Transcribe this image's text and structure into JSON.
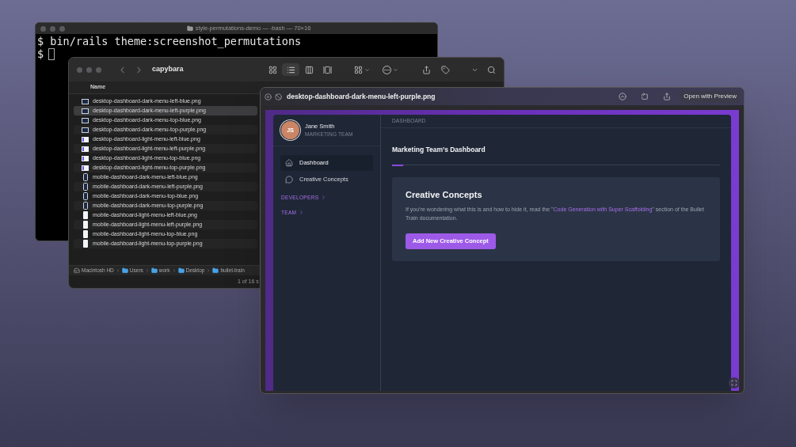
{
  "terminal": {
    "title": "style-permutations-demo — -bash — 70×16",
    "lines": [
      {
        "text": "$ bin/rails theme:screenshot_permutations",
        "cursor": false
      },
      {
        "text": "$",
        "cursor": true
      }
    ]
  },
  "finder": {
    "title": "capybara",
    "column": "Name",
    "files": [
      {
        "name": "desktop-dashboard-dark-menu-left-blue.png",
        "kind": "desktop-dark",
        "selected": false
      },
      {
        "name": "desktop-dashboard-dark-menu-left-purple.png",
        "kind": "desktop-dark",
        "selected": true
      },
      {
        "name": "desktop-dashboard-dark-menu-top-blue.png",
        "kind": "desktop-dark",
        "selected": false
      },
      {
        "name": "desktop-dashboard-dark-menu-top-purple.png",
        "kind": "desktop-dark",
        "selected": false
      },
      {
        "name": "desktop-dashboard-light-menu-left-blue.png",
        "kind": "desktop-light",
        "selected": false
      },
      {
        "name": "desktop-dashboard-light-menu-left-purple.png",
        "kind": "desktop-light",
        "selected": false
      },
      {
        "name": "desktop-dashboard-light-menu-top-blue.png",
        "kind": "desktop-light",
        "selected": false
      },
      {
        "name": "desktop-dashboard-light-menu-top-purple.png",
        "kind": "desktop-light",
        "selected": false
      },
      {
        "name": "mobile-dashboard-dark-menu-left-blue.png",
        "kind": "mobile-dark",
        "selected": false
      },
      {
        "name": "mobile-dashboard-dark-menu-left-purple.png",
        "kind": "mobile-dark",
        "selected": false
      },
      {
        "name": "mobile-dashboard-dark-menu-top-blue.png",
        "kind": "mobile-dark",
        "selected": false
      },
      {
        "name": "mobile-dashboard-dark-menu-top-purple.png",
        "kind": "mobile-dark",
        "selected": false
      },
      {
        "name": "mobile-dashboard-light-menu-left-blue.png",
        "kind": "mobile-light",
        "selected": false
      },
      {
        "name": "mobile-dashboard-light-menu-left-purple.png",
        "kind": "mobile-light",
        "selected": false
      },
      {
        "name": "mobile-dashboard-light-menu-top-blue.png",
        "kind": "mobile-light",
        "selected": false
      },
      {
        "name": "mobile-dashboard-light-menu-top-purple.png",
        "kind": "mobile-light",
        "selected": false
      }
    ],
    "path": [
      {
        "label": "Macintosh HD",
        "kind": "disk"
      },
      {
        "label": "Users",
        "kind": "folder"
      },
      {
        "label": "work",
        "kind": "folder"
      },
      {
        "label": "Desktop",
        "kind": "folder"
      },
      {
        "label": "bullet-train",
        "kind": "folder"
      }
    ],
    "status": "1 of 16 s"
  },
  "quick_look": {
    "title": "desktop-dashboard-dark-menu-left-purple.png",
    "open_button": "Open with Preview"
  },
  "app": {
    "user": {
      "initials": "JS",
      "name": "Jane Smith",
      "team": "MARKETING TEAM"
    },
    "nav": [
      {
        "label": "Dashboard",
        "selected": true
      },
      {
        "label": "Creative Concepts",
        "selected": false
      }
    ],
    "sections": [
      "DEVELOPERS",
      "TEAM"
    ],
    "breadcrumb": "DASHBOARD",
    "heading": "Marketing Team’s Dashboard",
    "card": {
      "title": "Creative Concepts",
      "text_before": "If you’re wondering what this is and how to hide it, read the \"",
      "link": "Code Generation with Super Scaffolding",
      "text_after": "\" section of the Bullet Train documentation.",
      "button": "Add New Creative Concept"
    }
  }
}
